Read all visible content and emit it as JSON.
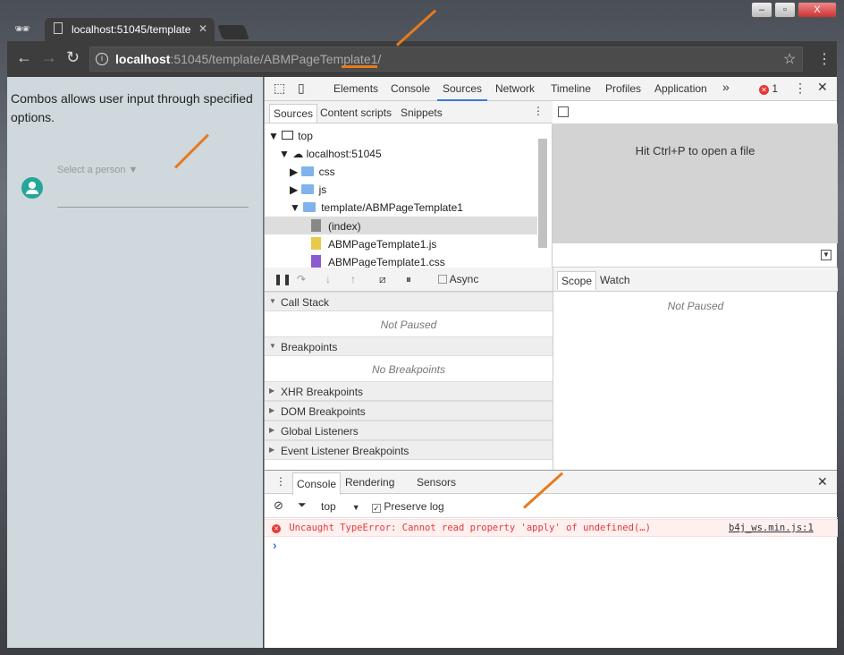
{
  "browser": {
    "tab_title": "localhost:51045/template",
    "url_host": "localhost",
    "url_rest": ":51045/template/ABMPageTemplate1/"
  },
  "page": {
    "description": "Combos allows user input through specified options.",
    "select_placeholder": "Select a person ▼"
  },
  "devtools": {
    "tabs": [
      "Elements",
      "Console",
      "Sources",
      "Network",
      "Timeline",
      "Profiles",
      "Application"
    ],
    "active_tab": "Sources",
    "more": "»",
    "error_count": "1",
    "navigator_tabs": [
      "Sources",
      "Content scripts",
      "Snippets"
    ],
    "tree": [
      "top",
      "localhost:51045",
      "css",
      "js",
      "template/ABMPageTemplate1",
      "(index)",
      "ABMPageTemplate1.js",
      "ABMPageTemplate1.css"
    ],
    "editor_hint": "Hit Ctrl+P to open a file",
    "async_label": "Async",
    "scope_tabs": [
      "Scope",
      "Watch"
    ],
    "scope_status": "Not Paused",
    "call_stack": "Call Stack",
    "call_stack_status": "Not Paused",
    "breakpoints": "Breakpoints",
    "breakpoints_status": "No Breakpoints",
    "sections": [
      "XHR Breakpoints",
      "DOM Breakpoints",
      "Global Listeners",
      "Event Listener Breakpoints"
    ],
    "drawer_tabs": [
      "Console",
      "Rendering",
      "Sensors"
    ],
    "context": "top",
    "preserve_log": "Preserve log",
    "error_message": "Uncaught TypeError: Cannot read property 'apply' of undefined(…)",
    "error_source": "b4j_ws.min.js:1",
    "prompt": "›"
  },
  "colors": {
    "accent": "#e87a1e",
    "error": "#e53935",
    "teal": "#26a69a"
  }
}
